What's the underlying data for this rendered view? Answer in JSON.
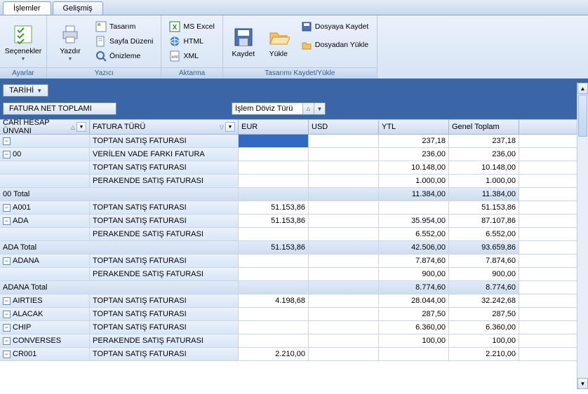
{
  "tabs": {
    "t0": "İşlemler",
    "t1": "Gelişmiş"
  },
  "ribbon": {
    "ayarlar": {
      "label": "Ayarlar",
      "secenekler": "Seçenekler"
    },
    "yazici": {
      "label": "Yazıcı",
      "yazdir": "Yazdır",
      "tasarim": "Tasarım",
      "sayfa": "Sayfa Düzeni",
      "onizleme": "Önizleme"
    },
    "aktarma": {
      "label": "Aktarma",
      "excel": "MS Excel",
      "html": "HTML",
      "xml": "XML"
    },
    "kaydet": {
      "label": "Tasarımı Kaydet/Yükle",
      "kaydet": "Kaydet",
      "yukle": "Yükle",
      "dosyaya": "Dosyaya Kaydet",
      "dosyadan": "Dosyadan Yükle"
    }
  },
  "filters": {
    "tarihi": "TARİHİ",
    "fnt": "FATURA NET TOPLAMI",
    "doviz_label": "İşlem Döviz Türü"
  },
  "cols": {
    "c0": "CARİ HESAP ÜNVANI",
    "c1": "FATURA TÜRÜ",
    "c2": "EUR",
    "c3": "USD",
    "c4": "YTL",
    "c5": "Genel Toplam"
  },
  "rows": [
    {
      "type": "data",
      "exp": "-",
      "acct": "",
      "ftur": "TOPTAN SATIŞ FATURASI",
      "eur": "",
      "usd": "",
      "ytl": "237,18",
      "tot": "237,18",
      "sel": true
    },
    {
      "type": "data",
      "exp": "-",
      "acct": "00",
      "ftur": "VERİLEN VADE FARKI FATURA",
      "eur": "",
      "usd": "",
      "ytl": "236,00",
      "tot": "236,00"
    },
    {
      "type": "data",
      "exp": "",
      "acct": "",
      "ftur": "TOPTAN SATIŞ FATURASI",
      "eur": "",
      "usd": "",
      "ytl": "10.148,00",
      "tot": "10.148,00"
    },
    {
      "type": "data",
      "exp": "",
      "acct": "",
      "ftur": "PERAKENDE SATIŞ FATURASI",
      "eur": "",
      "usd": "",
      "ytl": "1.000,00",
      "tot": "1.000,00"
    },
    {
      "type": "total",
      "exp": "",
      "acct": "00 Total",
      "ftur": "",
      "eur": "",
      "usd": "",
      "ytl": "11.384,00",
      "tot": "11.384,00"
    },
    {
      "type": "data",
      "exp": "-",
      "acct": "A001",
      "ftur": "TOPTAN SATIŞ FATURASI",
      "eur": "51.153,86",
      "usd": "",
      "ytl": "",
      "tot": "51.153,86"
    },
    {
      "type": "data",
      "exp": "-",
      "acct": "ADA",
      "ftur": "TOPTAN SATIŞ FATURASI",
      "eur": "51.153,86",
      "usd": "",
      "ytl": "35.954,00",
      "tot": "87.107,86"
    },
    {
      "type": "data",
      "exp": "",
      "acct": "",
      "ftur": "PERAKENDE SATIŞ FATURASI",
      "eur": "",
      "usd": "",
      "ytl": "6.552,00",
      "tot": "6.552,00"
    },
    {
      "type": "total",
      "exp": "",
      "acct": "ADA Total",
      "ftur": "",
      "eur": "51.153,86",
      "usd": "",
      "ytl": "42.506,00",
      "tot": "93.659,86"
    },
    {
      "type": "data",
      "exp": "-",
      "acct": "ADANA",
      "ftur": "TOPTAN SATIŞ FATURASI",
      "eur": "",
      "usd": "",
      "ytl": "7.874,60",
      "tot": "7.874,60"
    },
    {
      "type": "data",
      "exp": "",
      "acct": "",
      "ftur": "PERAKENDE SATIŞ FATURASI",
      "eur": "",
      "usd": "",
      "ytl": "900,00",
      "tot": "900,00"
    },
    {
      "type": "total",
      "exp": "",
      "acct": "ADANA Total",
      "ftur": "",
      "eur": "",
      "usd": "",
      "ytl": "8.774,60",
      "tot": "8.774,60"
    },
    {
      "type": "data",
      "exp": "-",
      "acct": "AIRTIES",
      "ftur": "TOPTAN SATIŞ FATURASI",
      "eur": "4.198,68",
      "usd": "",
      "ytl": "28.044,00",
      "tot": "32.242,68"
    },
    {
      "type": "data",
      "exp": "-",
      "acct": "ALACAK",
      "ftur": "TOPTAN SATIŞ FATURASI",
      "eur": "",
      "usd": "",
      "ytl": "287,50",
      "tot": "287,50"
    },
    {
      "type": "data",
      "exp": "-",
      "acct": "CHIP",
      "ftur": "TOPTAN SATIŞ FATURASI",
      "eur": "",
      "usd": "",
      "ytl": "6.360,00",
      "tot": "6.360,00"
    },
    {
      "type": "data",
      "exp": "-",
      "acct": "CONVERSES",
      "ftur": "PERAKENDE SATIŞ FATURASI",
      "eur": "",
      "usd": "",
      "ytl": "100,00",
      "tot": "100,00"
    },
    {
      "type": "data",
      "exp": "-",
      "acct": "CR001",
      "ftur": "TOPTAN SATIŞ FATURASI",
      "eur": "2.210,00",
      "usd": "",
      "ytl": "",
      "tot": "2.210,00"
    }
  ]
}
